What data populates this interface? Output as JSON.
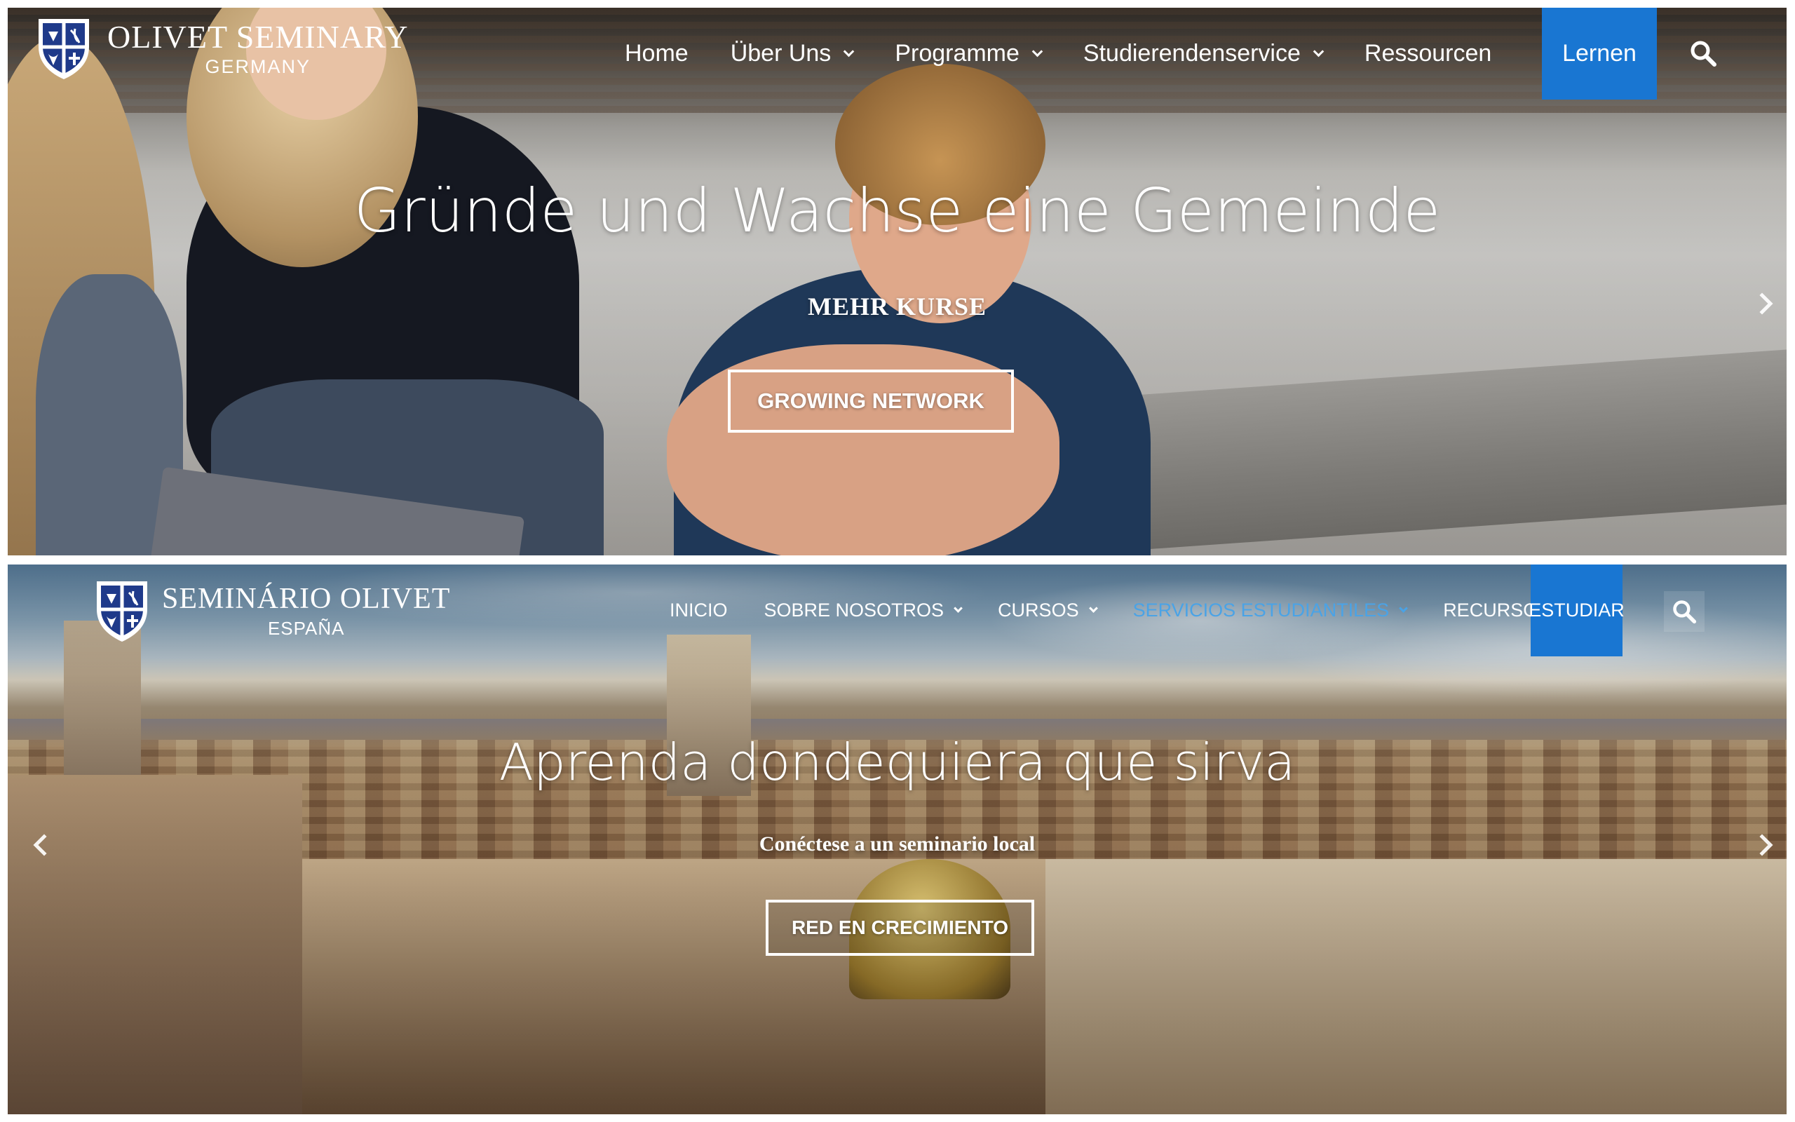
{
  "german_site": {
    "brand": {
      "name": "OLIVET SEMINARY",
      "subtitle": "GERMANY"
    },
    "nav": {
      "items": [
        {
          "label": "Home",
          "has_dropdown": false
        },
        {
          "label": "Über Uns",
          "has_dropdown": true
        },
        {
          "label": "Programme",
          "has_dropdown": true
        },
        {
          "label": "Studierendenservice",
          "has_dropdown": true
        },
        {
          "label": "Ressourcen",
          "has_dropdown": false
        }
      ],
      "cta_label": "Lernen",
      "search_icon": "search-icon"
    },
    "hero": {
      "title": "Gründe und Wachse eine Gemeinde",
      "subtitle": "MEHR KURSE",
      "button_label": "GROWING NETWORK",
      "next_icon": "chevron-right-icon"
    }
  },
  "spanish_site": {
    "brand": {
      "name": "SEMINÁRIO OLIVET",
      "subtitle": "ESPAÑA"
    },
    "nav": {
      "items": [
        {
          "label": "INICIO",
          "has_dropdown": false
        },
        {
          "label": "SOBRE NOSOTROS",
          "has_dropdown": true
        },
        {
          "label": "CURSOS",
          "has_dropdown": true
        },
        {
          "label": "SERVICIOS ESTUDIANTILES",
          "has_dropdown": true,
          "active": true
        },
        {
          "label": "RECURSOS",
          "has_dropdown": false
        }
      ],
      "cta_label": "ESTUDIAR",
      "search_icon": "search-icon"
    },
    "hero": {
      "title": "Aprenda dondequiera que sirva",
      "subtitle": "Conéctese a un seminario local",
      "button_label": "RED EN CRECIMIENTO",
      "prev_icon": "chevron-left-icon",
      "next_icon": "chevron-right-icon"
    }
  },
  "colors": {
    "accent": "#1976d2",
    "active_nav_text": "#4aa3e6",
    "shield": "#1f3a8a",
    "text": "#ffffff"
  }
}
